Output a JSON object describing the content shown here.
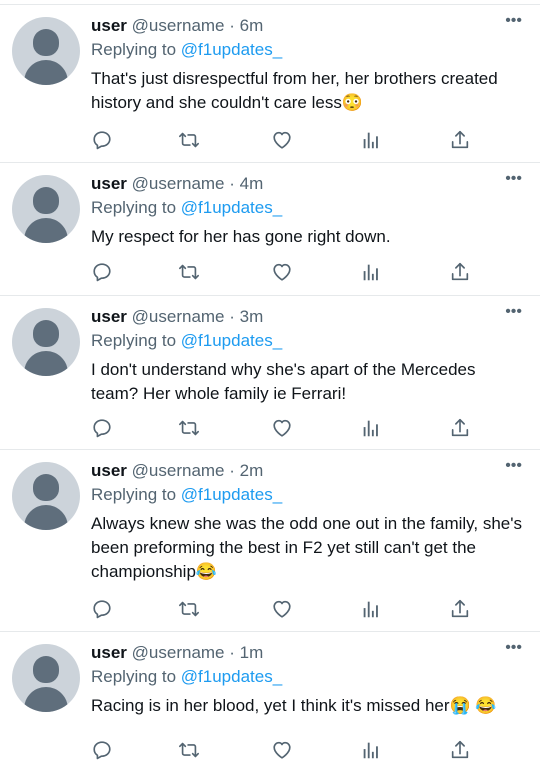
{
  "tweets": [
    {
      "name": "user",
      "handle": "@username",
      "time": "· 6m",
      "replying_label": "Replying to",
      "replying_handle": "@f1updates_",
      "text": "That's just disrespectful from her, her brothers created history and she couldn't care less😳"
    },
    {
      "name": "user",
      "handle": "@username",
      "time": "· 4m",
      "replying_label": "Replying to",
      "replying_handle": "@f1updates_",
      "text": "My respect for her has gone right down."
    },
    {
      "name": "user",
      "handle": "@username",
      "time": "· 3m",
      "replying_label": "Replying to",
      "replying_handle": "@f1updates_",
      "text": "I don't understand why she's apart of the Mercedes team? Her whole family ie Ferrari!"
    },
    {
      "name": "user",
      "handle": "@username",
      "time": "· 2m",
      "replying_label": "Replying to",
      "replying_handle": "@f1updates_",
      "text": "Always knew she was the odd one out in the family, she's been preforming the best in F2 yet still can't get the championship😂"
    },
    {
      "name": "user",
      "handle": "@username",
      "time": "· 1m",
      "replying_label": "Replying to",
      "replying_handle": "@f1updates_",
      "text": "Racing is in her blood, yet I think it's missed her😭 😂"
    }
  ],
  "more_glyph": "•••",
  "icons": [
    "reply-icon",
    "retweet-icon",
    "like-icon",
    "analytics-icon",
    "share-icon"
  ],
  "colors": {
    "secondary": "#536471",
    "link": "#1d9bf0",
    "divider": "#e6e9eb",
    "avatar_bg": "#ccd3da",
    "avatar_fg": "#5f6e7c"
  }
}
